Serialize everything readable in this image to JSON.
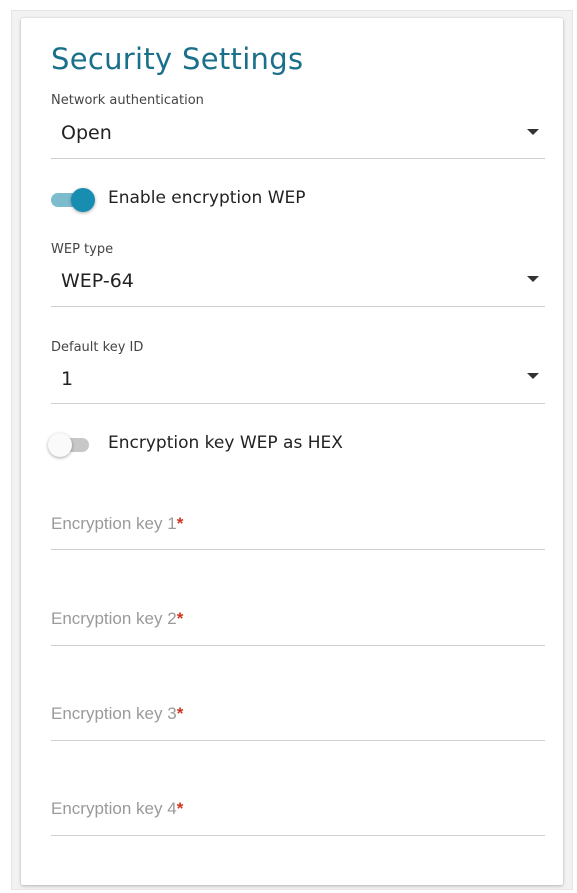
{
  "title": "Security Settings",
  "network_auth": {
    "label": "Network authentication",
    "value": "Open"
  },
  "enable_wep": {
    "label": "Enable encryption WEP",
    "checked": true
  },
  "wep_type": {
    "label": "WEP type",
    "value": "WEP-64"
  },
  "default_key": {
    "label": "Default key ID",
    "value": "1"
  },
  "hex_toggle": {
    "label": "Encryption key WEP as HEX",
    "checked": false
  },
  "keys": [
    {
      "placeholder": "Encryption key 1",
      "required": "*"
    },
    {
      "placeholder": "Encryption key 2",
      "required": "*"
    },
    {
      "placeholder": "Encryption key 3",
      "required": "*"
    },
    {
      "placeholder": "Encryption key 4",
      "required": "*"
    }
  ],
  "colors": {
    "title": "#1a6f8a",
    "accent": "#178db1",
    "required": "#d0341c"
  }
}
